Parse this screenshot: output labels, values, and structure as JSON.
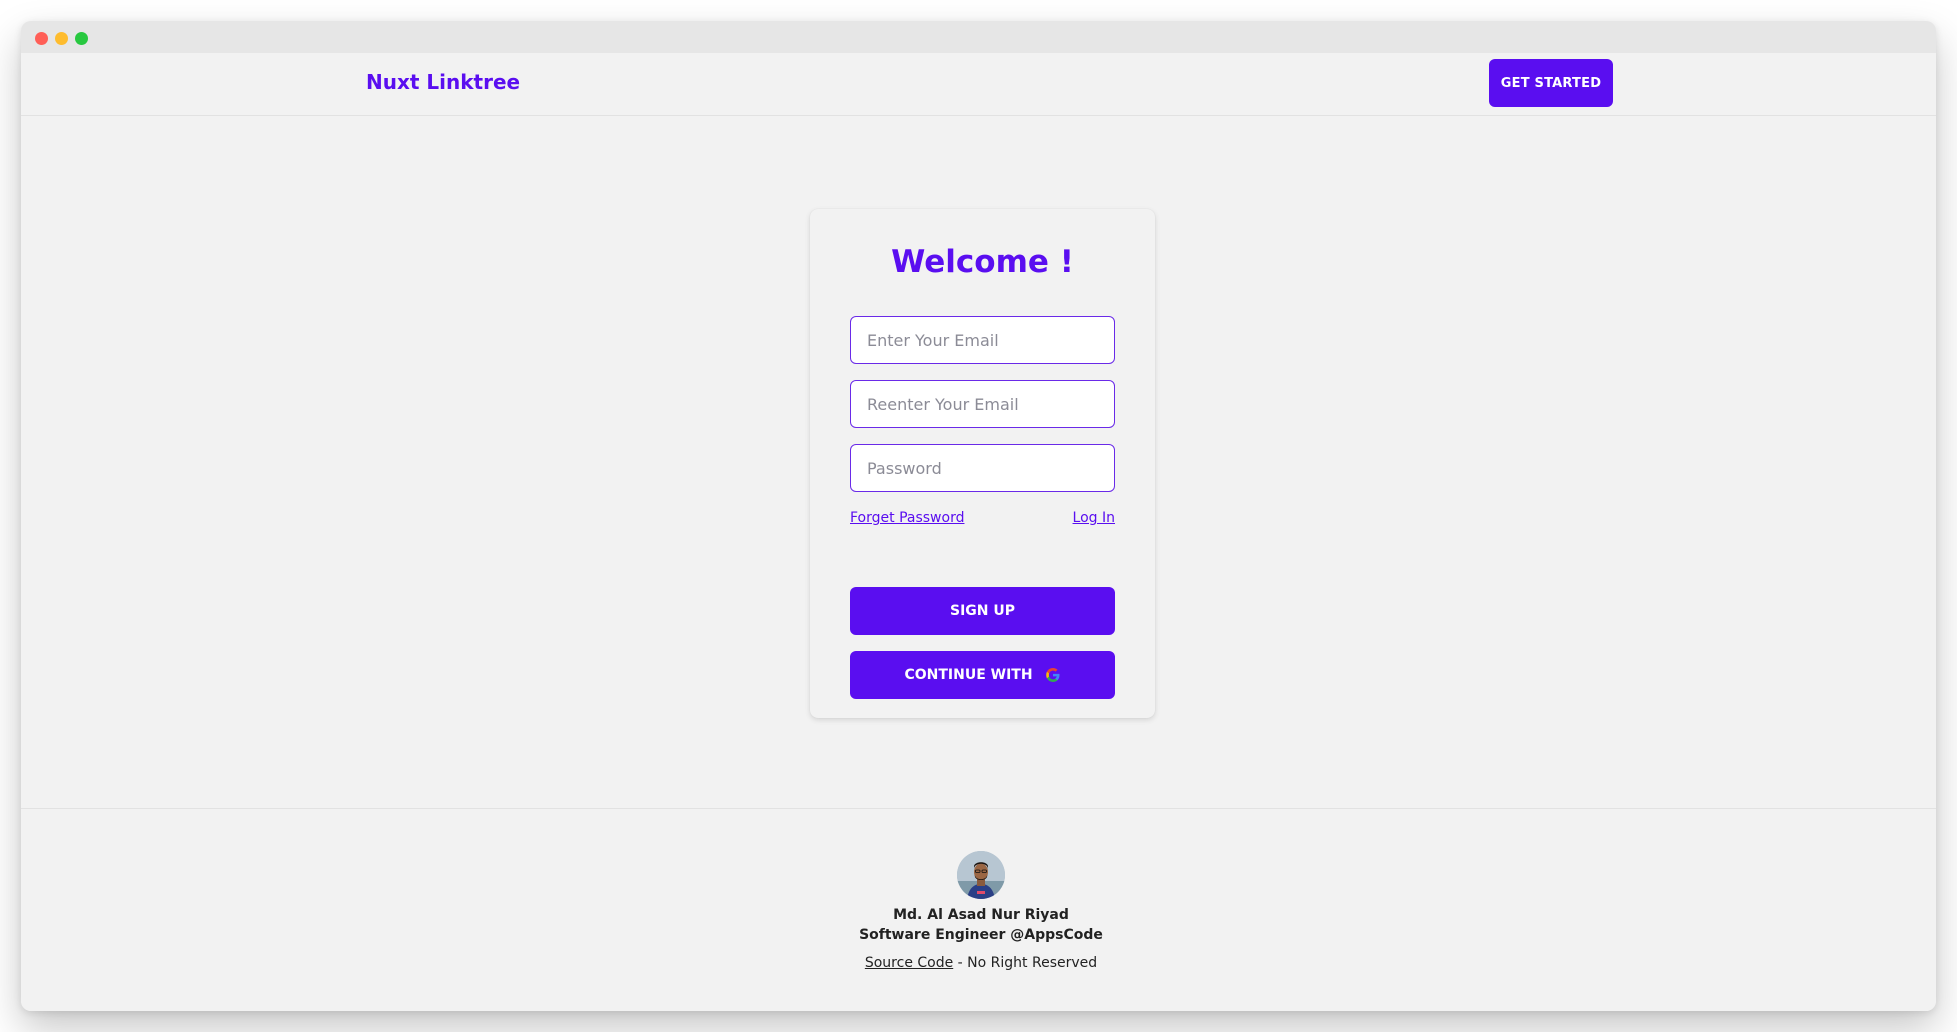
{
  "navbar": {
    "brand": "Nuxt Linktree",
    "get_started_label": "GET STARTED"
  },
  "form": {
    "title": "Welcome !",
    "email_placeholder": "Enter Your Email",
    "reenter_email_placeholder": "Reenter Your Email",
    "password_placeholder": "Password",
    "forget_password_label": "Forget Password",
    "login_label": "Log In",
    "signup_label": "SIGN UP",
    "continue_with_label": "CONTINUE WITH",
    "continue_with_icon": "google-icon"
  },
  "footer": {
    "avatar_icon": "avatar",
    "author_name": "Md. Al Asad Nur Riyad",
    "author_role": "Software Engineer @AppsCode",
    "source_code_label": "Source Code",
    "rights_text": " - No Right Reserved"
  },
  "colors": {
    "accent": "#5a0ef0",
    "background": "#f2f2f2",
    "text": "#222222"
  }
}
